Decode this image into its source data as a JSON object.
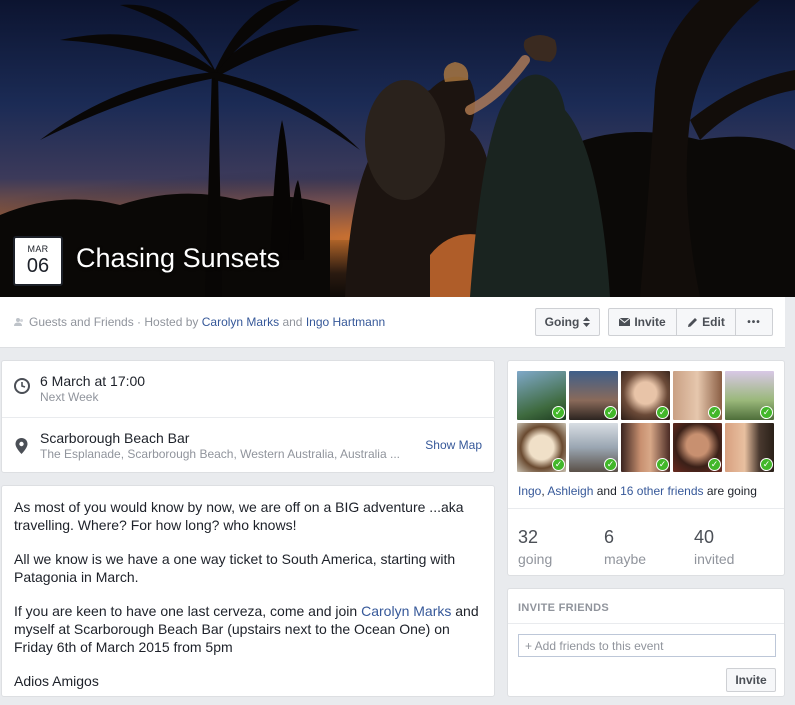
{
  "event": {
    "month": "MAR",
    "day": "06",
    "title": "Chasing Sunsets"
  },
  "info_bar": {
    "privacy": "Guests and Friends",
    "hosted_by": " · Hosted by ",
    "host1": "Carolyn Marks",
    "and": " and ",
    "host2": "Ingo Hartmann",
    "going_label": "Going",
    "invite_label": "Invite",
    "edit_label": "Edit",
    "more_label": "•••"
  },
  "details": {
    "time_main": "6 March at 17:00",
    "time_sub": "Next Week",
    "place_main": "Scarborough Beach Bar",
    "place_sub": "The Esplanade, Scarborough Beach, Western Australia, Australia ...",
    "show_map": "Show Map"
  },
  "description": {
    "p1": "As most of you would know by now, we are off on a BIG adventure ...aka travelling. Where? For how long? who knows!",
    "p2": "All we know is we have a one way ticket to South America, starting with Patagonia in March.",
    "p3_a": "If you are keen to have one last cerveza, come and join ",
    "p3_link": "Carolyn Marks",
    "p3_b": " and myself at Scarborough Beach Bar (upstairs next to the Ocean One) on Friday 6th of March 2015 from 5pm",
    "p4": "Adios Amigos"
  },
  "friends": {
    "going_name1": "Ingo",
    "going_sep": ", ",
    "going_name2": "Ashleigh",
    "going_and": " and ",
    "going_others": "16 other friends",
    "going_tail": " are going",
    "stats": [
      {
        "num": "32",
        "label": "going"
      },
      {
        "num": "6",
        "label": "maybe"
      },
      {
        "num": "40",
        "label": "invited"
      }
    ],
    "check_glyph": "✓"
  },
  "invite": {
    "header": "INVITE FRIENDS",
    "placeholder": "+ Add friends to this event",
    "button": "Invite"
  },
  "colors": {
    "link": "#365899",
    "check": "#42b72a",
    "page_bg": "#e9ebee"
  }
}
